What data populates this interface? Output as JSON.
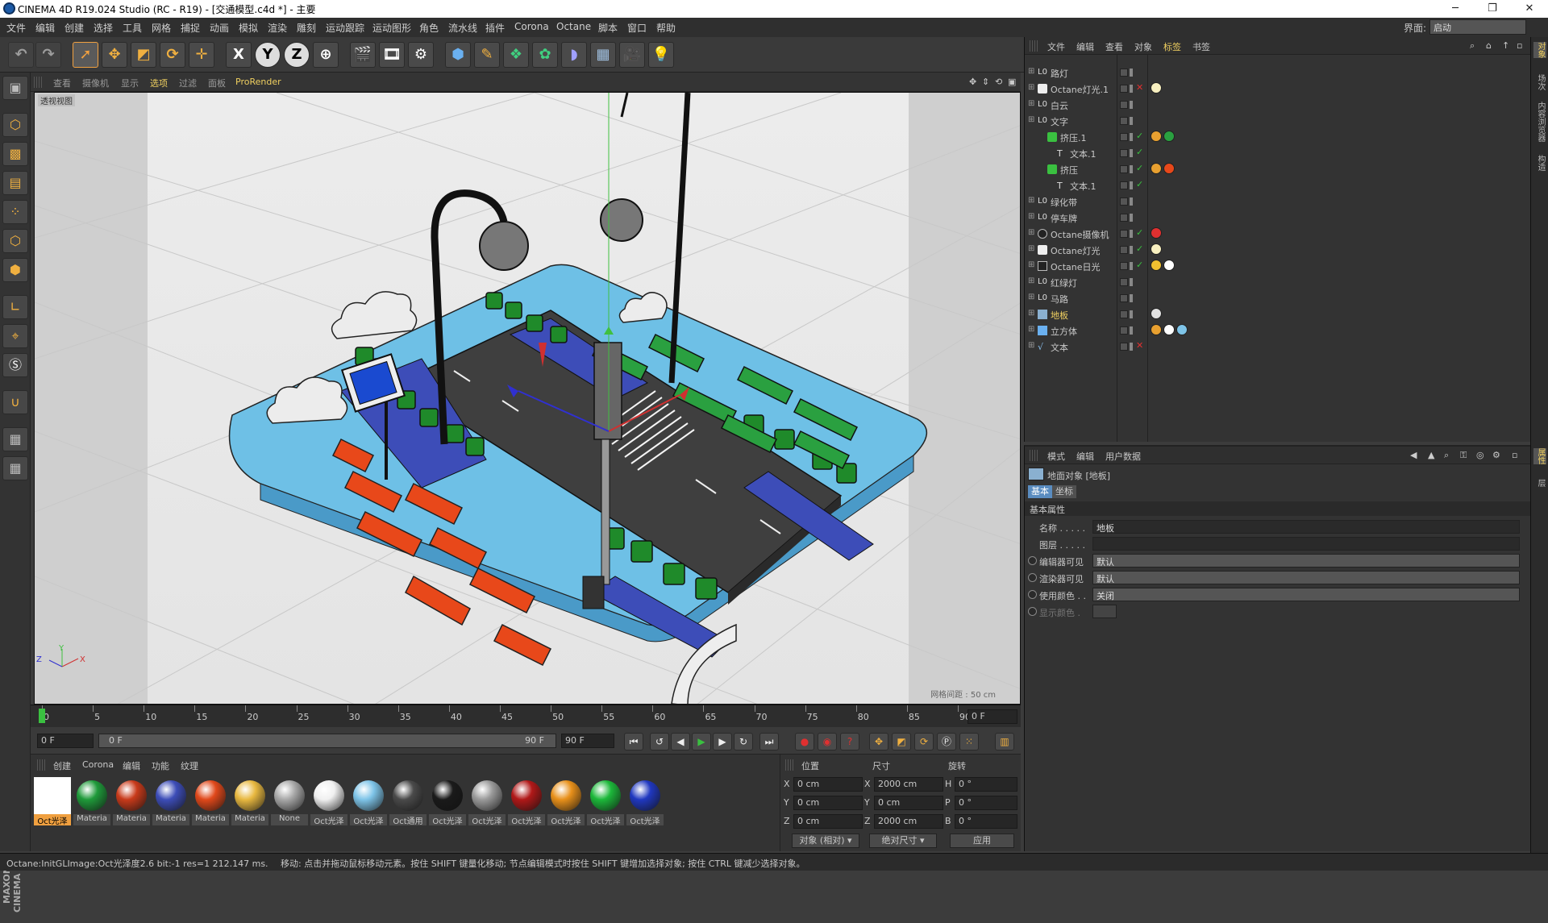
{
  "window": {
    "title": "CINEMA 4D R19.024 Studio (RC - R19) - [交通模型.c4d *] - 主要",
    "minimize": "─",
    "restore": "❐",
    "close": "✕"
  },
  "menu": [
    "文件",
    "编辑",
    "创建",
    "选择",
    "工具",
    "网格",
    "捕捉",
    "动画",
    "模拟",
    "渲染",
    "雕刻",
    "运动跟踪",
    "运动图形",
    "角色",
    "流水线",
    "插件",
    "Corona",
    "Octane",
    "脚本",
    "窗口",
    "帮助"
  ],
  "layout": {
    "label": "界面:",
    "value": "启动"
  },
  "toolbar": {
    "x_label": "X",
    "y_label": "Y",
    "z_label": "Z"
  },
  "viewport": {
    "menu": [
      "查看",
      "摄像机",
      "显示",
      "选项",
      "过滤",
      "面板",
      "ProRender"
    ],
    "camera_label": "透视视图",
    "grid_label": "网格间距 : 50 cm",
    "axis_z": "Z",
    "axis_y": "Y",
    "axis_x": "X"
  },
  "timeline": {
    "ticks": [
      "0",
      "5",
      "10",
      "15",
      "20",
      "25",
      "30",
      "35",
      "40",
      "45",
      "50",
      "55",
      "60",
      "65",
      "70",
      "75",
      "80",
      "85",
      "90"
    ],
    "current_frame": "0 F",
    "start": "0 F",
    "range_start": "0 F",
    "range_end": "90 F",
    "end": "90 F"
  },
  "materials": {
    "tabs": [
      "创建",
      "Corona",
      "编辑",
      "功能",
      "纹理"
    ],
    "items": [
      {
        "label": "Oct光泽",
        "color": "#ffffff"
      },
      {
        "label": "Materia",
        "color": "#1f9a3a"
      },
      {
        "label": "Materia",
        "color": "#c83a1a"
      },
      {
        "label": "Materia",
        "color": "#3d4db8"
      },
      {
        "label": "Materia",
        "color": "#e0481a"
      },
      {
        "label": "Materia",
        "color": "#e8b840"
      },
      {
        "label": "None",
        "color": "#a8a8a8"
      },
      {
        "label": "Oct光泽",
        "color": "#f0f0f0"
      },
      {
        "label": "Oct光泽",
        "color": "#7ec4e8"
      },
      {
        "label": "Oct通用",
        "color": "#4a4a4a"
      },
      {
        "label": "Oct光泽",
        "color": "#1a1a1a"
      },
      {
        "label": "Oct光泽",
        "color": "#9a9a9a"
      },
      {
        "label": "Oct光泽",
        "color": "#b01818"
      },
      {
        "label": "Oct光泽",
        "color": "#e8901a"
      },
      {
        "label": "Oct光泽",
        "color": "#1cb83a"
      },
      {
        "label": "Oct光泽",
        "color": "#2038c0"
      }
    ]
  },
  "coords": {
    "headers": {
      "position": "位置",
      "size": "尺寸",
      "rotation": "旋转"
    },
    "rows": [
      {
        "axis": "X",
        "pos": "0 cm",
        "saxis": "X",
        "size": "2000 cm",
        "raxis": "H",
        "rot": "0 °"
      },
      {
        "axis": "Y",
        "pos": "0 cm",
        "saxis": "Y",
        "size": "0 cm",
        "raxis": "P",
        "rot": "0 °"
      },
      {
        "axis": "Z",
        "pos": "0 cm",
        "saxis": "Z",
        "size": "2000 cm",
        "raxis": "B",
        "rot": "0 °"
      }
    ],
    "mode_select": "对象 (相对)",
    "size_select": "绝对尺寸",
    "apply": "应用"
  },
  "status": {
    "left": "Octane:InitGLImage:Oct光泽度2.6  bit:-1 res=1  212.147 ms.",
    "right": "移动: 点击并拖动鼠标移动元素。按住 SHIFT 键量化移动; 节点编辑模式时按住 SHIFT 键增加选择对象; 按住 CTRL 键减少选择对象。"
  },
  "object_manager": {
    "menu": [
      "文件",
      "编辑",
      "查看",
      "对象",
      "标签",
      "书签"
    ],
    "objects": [
      {
        "name": "路灯",
        "indent": 0,
        "icon": "null",
        "check": ""
      },
      {
        "name": "Octane灯光.1",
        "indent": 0,
        "icon": "light",
        "check": "✕"
      },
      {
        "name": "白云",
        "indent": 0,
        "icon": "null",
        "check": ""
      },
      {
        "name": "文字",
        "indent": 0,
        "icon": "null",
        "check": ""
      },
      {
        "name": "挤压.1",
        "indent": 1,
        "icon": "extrude",
        "check": "✓"
      },
      {
        "name": "文本.1",
        "indent": 2,
        "icon": "text",
        "check": "✓"
      },
      {
        "name": "挤压",
        "indent": 1,
        "icon": "extrude",
        "check": "✓"
      },
      {
        "name": "文本.1",
        "indent": 2,
        "icon": "text",
        "check": "✓"
      },
      {
        "name": "绿化带",
        "indent": 0,
        "icon": "null",
        "check": ""
      },
      {
        "name": "停车牌",
        "indent": 0,
        "icon": "null",
        "check": ""
      },
      {
        "name": "Octane摄像机",
        "indent": 0,
        "icon": "camera",
        "check": "✓"
      },
      {
        "name": "Octane灯光",
        "indent": 0,
        "icon": "light",
        "check": "✓"
      },
      {
        "name": "Octane日光",
        "indent": 0,
        "icon": "sun",
        "check": "✓"
      },
      {
        "name": "红绿灯",
        "indent": 0,
        "icon": "null",
        "check": ""
      },
      {
        "name": "马路",
        "indent": 0,
        "icon": "null",
        "check": ""
      },
      {
        "name": "地板",
        "indent": 0,
        "icon": "floor",
        "check": "",
        "selected": true
      },
      {
        "name": "立方体",
        "indent": 0,
        "icon": "cube",
        "check": ""
      },
      {
        "name": "文本",
        "indent": 0,
        "icon": "spline",
        "check": "✕"
      }
    ]
  },
  "attr_manager": {
    "menu": [
      "模式",
      "编辑",
      "用户数据"
    ],
    "object_label": "地面对象 [地板]",
    "tabs": [
      "基本",
      "坐标"
    ],
    "section": "基本属性",
    "fields": [
      {
        "label": "名称 . . . . .",
        "value": "地板"
      },
      {
        "label": "图层 . . . . .",
        "value": ""
      },
      {
        "label": "编辑器可见",
        "value": "默认"
      },
      {
        "label": "渲染器可见",
        "value": "默认"
      },
      {
        "label": "使用颜色 . .",
        "value": "关闭"
      },
      {
        "label": "显示颜色 .",
        "value": ""
      }
    ]
  },
  "right_strip": [
    "对象",
    "场次",
    "内容浏览器",
    "构造",
    "属性",
    "层"
  ]
}
